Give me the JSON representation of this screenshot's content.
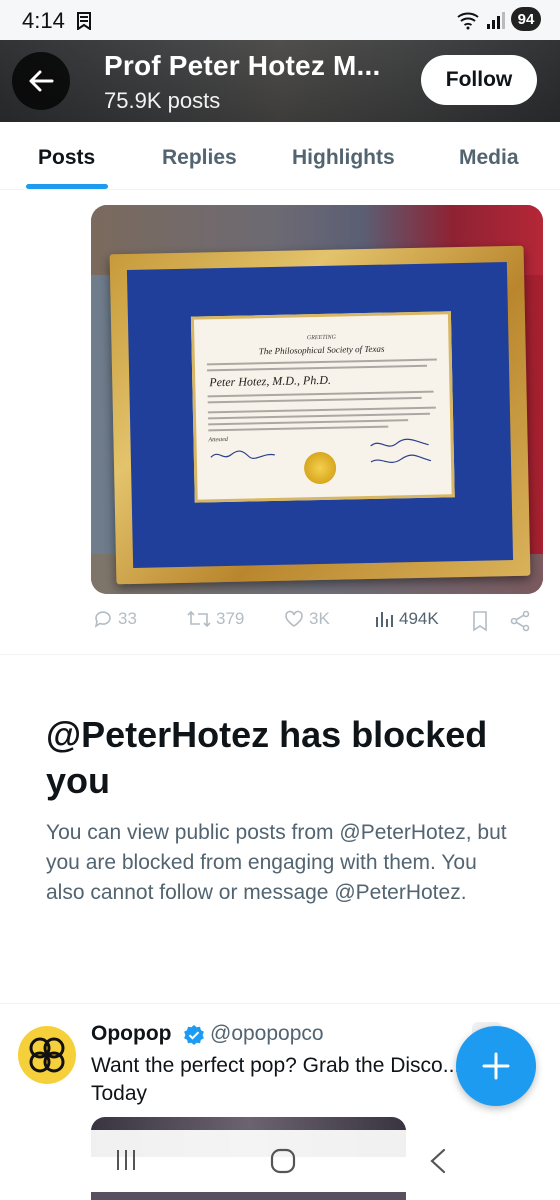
{
  "status_bar": {
    "time": "4:14",
    "battery": "94"
  },
  "header": {
    "title": "Prof Peter Hotez M...",
    "post_count": "75.9K posts",
    "follow_label": "Follow"
  },
  "tabs": [
    {
      "label": "Posts",
      "active": true
    },
    {
      "label": "Replies",
      "active": false
    },
    {
      "label": "Highlights",
      "active": false
    },
    {
      "label": "Media",
      "active": false
    }
  ],
  "tweet": {
    "certificate": {
      "heading": "The Philosophical Society of Texas",
      "greeting": "GREETING",
      "recipient": "Peter Hotez, M.D., Ph.D.",
      "attested": "Attested"
    },
    "actions": {
      "replies": "33",
      "reposts": "379",
      "likes": "3K",
      "views": "494K"
    }
  },
  "blocked": {
    "title": "@PeterHotez has blocked you",
    "body": "You can view public posts from @PeterHotez, but you are blocked from engaging with them. You also cannot follow or message @PeterHotez."
  },
  "ad": {
    "name": "Opopop",
    "handle": "@opopopco",
    "text": "Want the perfect pop? Grab the Disco... Today"
  },
  "colors": {
    "accent": "#1d9bf0",
    "text_primary": "#0f1419",
    "text_secondary": "#536471"
  }
}
